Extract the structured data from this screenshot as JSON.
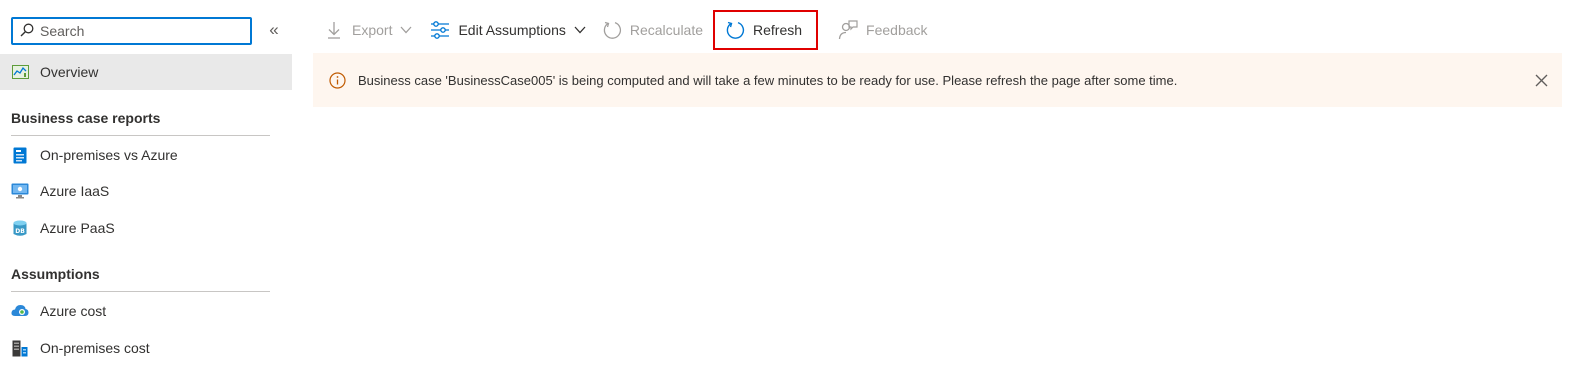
{
  "sidebar": {
    "search": {
      "placeholder": "Search",
      "value": ""
    },
    "collapse_glyph": "«",
    "overview_label": "Overview",
    "sections": [
      {
        "title": "Business case reports",
        "items": [
          {
            "label": "On-premises vs Azure",
            "icon": "report-document-icon"
          },
          {
            "label": "Azure IaaS",
            "icon": "virtual-machine-icon"
          },
          {
            "label": "Azure PaaS",
            "icon": "database-icon"
          }
        ]
      },
      {
        "title": "Assumptions",
        "items": [
          {
            "label": "Azure cost",
            "icon": "cloud-cost-icon"
          },
          {
            "label": "On-premises cost",
            "icon": "server-building-icon"
          }
        ]
      }
    ]
  },
  "toolbar": {
    "export_label": "Export",
    "edit_assumptions_label": "Edit Assumptions",
    "recalculate_label": "Recalculate",
    "refresh_label": "Refresh",
    "feedback_label": "Feedback"
  },
  "banner": {
    "message": "Business case 'BusinessCase005' is being computed and will take a few minutes to be ready for use. Please refresh the page after some time."
  },
  "colors": {
    "accent": "#0078d4",
    "highlight": "#e00000",
    "banner_bg": "#fef6ef",
    "warning": "#c05a00"
  }
}
